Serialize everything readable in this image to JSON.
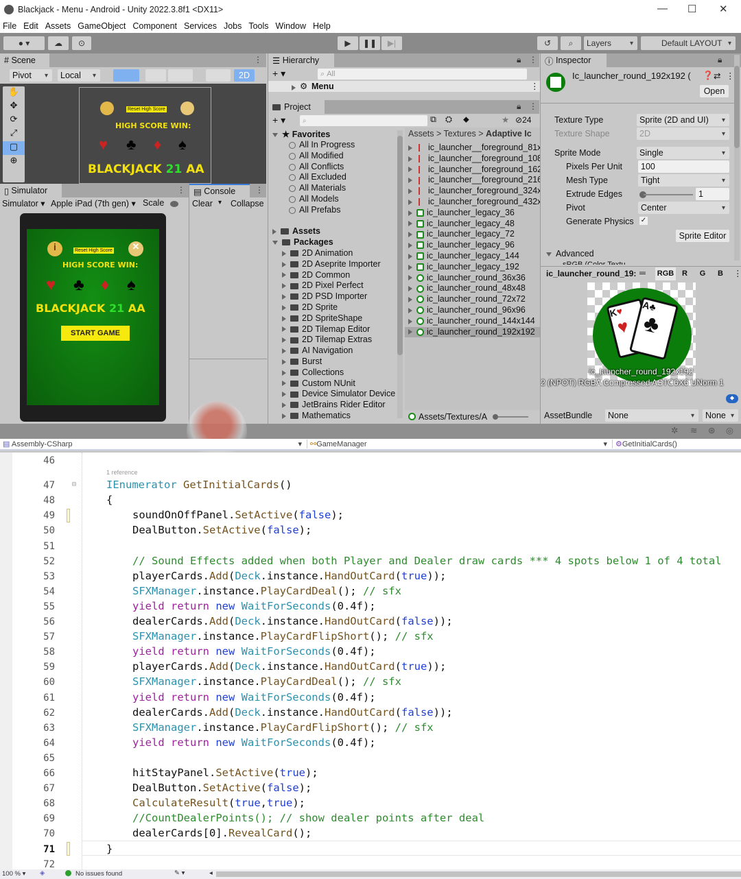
{
  "window": {
    "title": "Blackjack - Menu - Android - Unity 2022.3.8f1 <DX11>",
    "minimize": "—",
    "maximize": "☐",
    "close": "✕"
  },
  "menu": [
    "File",
    "Edit",
    "Assets",
    "GameObject",
    "Component",
    "Services",
    "Jobs",
    "Tools",
    "Window",
    "Help"
  ],
  "toolbar": {
    "layers": "Layers",
    "layout": "Default LAYOUT"
  },
  "scene": {
    "tab": "Scene",
    "pivot": "Pivot",
    "local": "Local",
    "mode2d": "2D",
    "game": {
      "reset": "Reset High Score",
      "highscore": "HIGH SCORE WIN:",
      "title_a": "BLACKJACK ",
      "title_b": "21",
      "title_c": " AA",
      "start": "START GAME"
    }
  },
  "simulator": {
    "tab": "Simulator",
    "mode": "Simulator",
    "device": "Apple iPad (7th gen)",
    "scale": "Scale"
  },
  "console": {
    "tab": "Console",
    "clear": "Clear",
    "collapse": "Collapse"
  },
  "hierarchy": {
    "tab": "Hierarchy",
    "search_placeholder": "All",
    "scene_item": "Menu"
  },
  "project": {
    "tab": "Project",
    "hidden_count": "24",
    "favorites_label": "Favorites",
    "favorites": [
      "All In Progress",
      "All Modified",
      "All Conflicts",
      "All Excluded",
      "All Materials",
      "All Models",
      "All Prefabs"
    ],
    "assets_label": "Assets",
    "packages_label": "Packages",
    "packages": [
      "2D Animation",
      "2D Aseprite Importer",
      "2D Common",
      "2D Pixel Perfect",
      "2D PSD Importer",
      "2D Sprite",
      "2D SpriteShape",
      "2D Tilemap Editor",
      "2D Tilemap Extras",
      "AI Navigation",
      "Burst",
      "Collections",
      "Custom NUnit",
      "Device Simulator Device",
      "JetBrains Rider Editor",
      "Mathematics"
    ],
    "breadcrumb": [
      "Assets",
      "Textures",
      "Adaptive Ic"
    ],
    "files": [
      {
        "name": "ic_launcher__foreground_81x",
        "kind": "fg"
      },
      {
        "name": "ic_launcher__foreground_108",
        "kind": "fg"
      },
      {
        "name": "ic_launcher__foreground_162",
        "kind": "fg"
      },
      {
        "name": "ic_launcher__foreground_216",
        "kind": "fg"
      },
      {
        "name": "ic_launcher_foreground_324x",
        "kind": "fg"
      },
      {
        "name": "ic_launcher_foreground_432x",
        "kind": "fg"
      },
      {
        "name": "ic_launcher_legacy_36",
        "kind": "legacy"
      },
      {
        "name": "ic_launcher_legacy_48",
        "kind": "legacy"
      },
      {
        "name": "ic_launcher_legacy_72",
        "kind": "legacy"
      },
      {
        "name": "ic_launcher_legacy_96",
        "kind": "legacy"
      },
      {
        "name": "ic_launcher_legacy_144",
        "kind": "legacy"
      },
      {
        "name": "ic_launcher_legacy_192",
        "kind": "legacy"
      },
      {
        "name": "ic_launcher_round_36x36",
        "kind": "round"
      },
      {
        "name": "ic_launcher_round_48x48",
        "kind": "round"
      },
      {
        "name": "ic_launcher_round_72x72",
        "kind": "round"
      },
      {
        "name": "ic_launcher_round_96x96",
        "kind": "round"
      },
      {
        "name": "ic_launcher_round_144x144",
        "kind": "round"
      },
      {
        "name": "ic_launcher_round_192x192",
        "kind": "round",
        "selected": true
      }
    ],
    "footer_path": "Assets/Textures/A"
  },
  "inspector": {
    "tab": "Inspector",
    "asset_name": "Ic_launcher_round_192x192 (",
    "open": "Open",
    "texture_type_label": "Texture Type",
    "texture_type": "Sprite (2D and UI)",
    "texture_shape_label": "Texture Shape",
    "texture_shape": "2D",
    "sprite_mode_label": "Sprite Mode",
    "sprite_mode": "Single",
    "ppu_label": "Pixels Per Unit",
    "ppu": "100",
    "mesh_type_label": "Mesh Type",
    "mesh_type": "Tight",
    "extrude_label": "Extrude Edges",
    "extrude": "1",
    "pivot_label": "Pivot",
    "pivot": "Center",
    "gen_physics_label": "Generate Physics",
    "gen_physics": "✓",
    "sprite_editor": "Sprite Editor",
    "advanced": "Advanced",
    "srgb": "sRGB (Color Textu",
    "preview_name": "ic_launcher_round_19:",
    "channels": [
      "RGB",
      "R",
      "G",
      "B"
    ],
    "preview_caption": "ic_launcher_round_192x192",
    "preview_info": "2 (NPOT)  RGBA Compressed ASTC6X6 UNorm  1",
    "assetbundle_label": "AssetBundle",
    "assetbundle": "None",
    "variant": "None"
  },
  "editor": {
    "project": "Assembly-CSharp",
    "class": "GameManager",
    "method": "GetInitialCards()",
    "codelens": "1 reference",
    "zoom": "100 %",
    "status": "No issues found",
    "lines": [
      {
        "n": "46",
        "tokens": []
      },
      {
        "n": "47",
        "tokens": [
          [
            "ty",
            "IEnumerator "
          ],
          [
            "mt",
            "GetInitialCards"
          ],
          [
            "",
            "()"
          ]
        ],
        "indent": 0
      },
      {
        "n": "48",
        "tokens": [
          [
            "",
            "{"
          ]
        ],
        "indent": 0
      },
      {
        "n": "49",
        "tokens": [
          [
            "",
            "soundOnOffPanel."
          ],
          [
            "mt",
            "SetActive"
          ],
          [
            "",
            "("
          ],
          [
            "k1",
            "false"
          ],
          [
            "",
            ");"
          ]
        ],
        "indent": 1
      },
      {
        "n": "50",
        "tokens": [
          [
            "",
            "DealButton."
          ],
          [
            "mt",
            "SetActive"
          ],
          [
            "",
            "("
          ],
          [
            "k1",
            "false"
          ],
          [
            "",
            ");"
          ]
        ],
        "indent": 1
      },
      {
        "n": "51",
        "tokens": []
      },
      {
        "n": "52",
        "tokens": [
          [
            "cm",
            "// Sound Effects added when both Player and Dealer draw cards *** 4 spots below 1 of 4 total"
          ]
        ],
        "indent": 1
      },
      {
        "n": "53",
        "tokens": [
          [
            "",
            "playerCards."
          ],
          [
            "mt",
            "Add"
          ],
          [
            "",
            "("
          ],
          [
            "ty",
            "Deck"
          ],
          [
            "",
            ".instance."
          ],
          [
            "mt",
            "HandOutCard"
          ],
          [
            "",
            "("
          ],
          [
            "k1",
            "true"
          ],
          [
            "",
            "));"
          ]
        ],
        "indent": 1
      },
      {
        "n": "54",
        "tokens": [
          [
            "ty",
            "SFXManager"
          ],
          [
            "",
            ".instance."
          ],
          [
            "mt",
            "PlayCardDeal"
          ],
          [
            "",
            "(); "
          ],
          [
            "cm",
            "// sfx"
          ]
        ],
        "indent": 1
      },
      {
        "n": "55",
        "tokens": [
          [
            "k2",
            "yield return "
          ],
          [
            "k1",
            "new "
          ],
          [
            "ty",
            "WaitForSeconds"
          ],
          [
            "",
            "(0.4f);"
          ]
        ],
        "indent": 1
      },
      {
        "n": "56",
        "tokens": [
          [
            "",
            "dealerCards."
          ],
          [
            "mt",
            "Add"
          ],
          [
            "",
            "("
          ],
          [
            "ty",
            "Deck"
          ],
          [
            "",
            ".instance."
          ],
          [
            "mt",
            "HandOutCard"
          ],
          [
            "",
            "("
          ],
          [
            "k1",
            "false"
          ],
          [
            "",
            "));"
          ]
        ],
        "indent": 1
      },
      {
        "n": "57",
        "tokens": [
          [
            "ty",
            "SFXManager"
          ],
          [
            "",
            ".instance."
          ],
          [
            "mt",
            "PlayCardFlipShort"
          ],
          [
            "",
            "(); "
          ],
          [
            "cm",
            "// sfx"
          ]
        ],
        "indent": 1
      },
      {
        "n": "58",
        "tokens": [
          [
            "k2",
            "yield return "
          ],
          [
            "k1",
            "new "
          ],
          [
            "ty",
            "WaitForSeconds"
          ],
          [
            "",
            "(0.4f);"
          ]
        ],
        "indent": 1
      },
      {
        "n": "59",
        "tokens": [
          [
            "",
            "playerCards."
          ],
          [
            "mt",
            "Add"
          ],
          [
            "",
            "("
          ],
          [
            "ty",
            "Deck"
          ],
          [
            "",
            ".instance."
          ],
          [
            "mt",
            "HandOutCard"
          ],
          [
            "",
            "("
          ],
          [
            "k1",
            "true"
          ],
          [
            "",
            "));"
          ]
        ],
        "indent": 1
      },
      {
        "n": "60",
        "tokens": [
          [
            "ty",
            "SFXManager"
          ],
          [
            "",
            ".instance."
          ],
          [
            "mt",
            "PlayCardDeal"
          ],
          [
            "",
            "(); "
          ],
          [
            "cm",
            "// sfx"
          ]
        ],
        "indent": 1
      },
      {
        "n": "61",
        "tokens": [
          [
            "k2",
            "yield return "
          ],
          [
            "k1",
            "new "
          ],
          [
            "ty",
            "WaitForSeconds"
          ],
          [
            "",
            "(0.4f);"
          ]
        ],
        "indent": 1
      },
      {
        "n": "62",
        "tokens": [
          [
            "",
            "dealerCards."
          ],
          [
            "mt",
            "Add"
          ],
          [
            "",
            "("
          ],
          [
            "ty",
            "Deck"
          ],
          [
            "",
            ".instance."
          ],
          [
            "mt",
            "HandOutCard"
          ],
          [
            "",
            "("
          ],
          [
            "k1",
            "false"
          ],
          [
            "",
            "));"
          ]
        ],
        "indent": 1
      },
      {
        "n": "63",
        "tokens": [
          [
            "ty",
            "SFXManager"
          ],
          [
            "",
            ".instance."
          ],
          [
            "mt",
            "PlayCardFlipShort"
          ],
          [
            "",
            "(); "
          ],
          [
            "cm",
            "// sfx"
          ]
        ],
        "indent": 1
      },
      {
        "n": "64",
        "tokens": [
          [
            "k2",
            "yield return "
          ],
          [
            "k1",
            "new "
          ],
          [
            "ty",
            "WaitForSeconds"
          ],
          [
            "",
            "(0.4f);"
          ]
        ],
        "indent": 1
      },
      {
        "n": "65",
        "tokens": []
      },
      {
        "n": "66",
        "tokens": [
          [
            "",
            "hitStayPanel."
          ],
          [
            "mt",
            "SetActive"
          ],
          [
            "",
            "("
          ],
          [
            "k1",
            "true"
          ],
          [
            "",
            ");"
          ]
        ],
        "indent": 1
      },
      {
        "n": "67",
        "tokens": [
          [
            "",
            "DealButton."
          ],
          [
            "mt",
            "SetActive"
          ],
          [
            "",
            "("
          ],
          [
            "k1",
            "false"
          ],
          [
            "",
            ");"
          ]
        ],
        "indent": 1
      },
      {
        "n": "68",
        "tokens": [
          [
            "mt",
            "CalculateResult"
          ],
          [
            "",
            "("
          ],
          [
            "k1",
            "true"
          ],
          [
            "",
            ","
          ],
          [
            "k1",
            "true"
          ],
          [
            "",
            ");"
          ]
        ],
        "indent": 1
      },
      {
        "n": "69",
        "tokens": [
          [
            "cm",
            "//CountDealerPoints(); // show dealer points after deal"
          ]
        ],
        "indent": 1
      },
      {
        "n": "70",
        "tokens": [
          [
            "",
            "dealerCards[0]."
          ],
          [
            "mt",
            "RevealCard"
          ],
          [
            "",
            "();"
          ]
        ],
        "indent": 1
      },
      {
        "n": "71",
        "tokens": [
          [
            "",
            "}"
          ]
        ],
        "indent": 0
      },
      {
        "n": "72",
        "tokens": []
      }
    ]
  }
}
